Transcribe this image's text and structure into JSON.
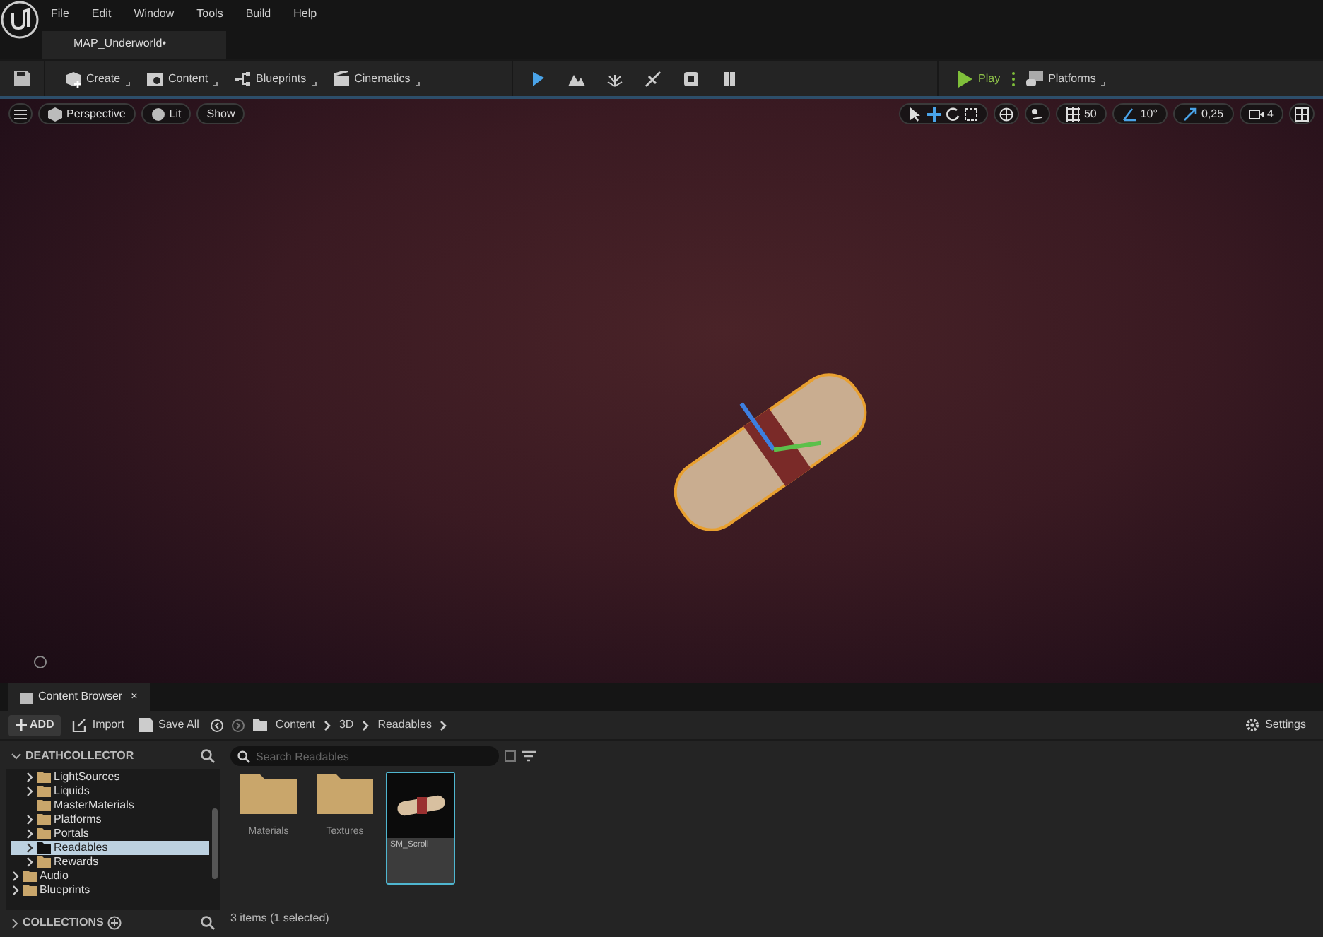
{
  "menu": [
    "File",
    "Edit",
    "Window",
    "Tools",
    "Build",
    "Help"
  ],
  "document_tab": {
    "label": "MAP_Underworld•"
  },
  "toolbar": {
    "menus": [
      {
        "label": "Create"
      },
      {
        "label": "Content"
      },
      {
        "label": "Blueprints"
      },
      {
        "label": "Cinematics"
      }
    ],
    "play": "Play",
    "platforms": "Platforms"
  },
  "viewport": {
    "left_buttons": [
      "Perspective",
      "Lit",
      "Show"
    ],
    "snap_values": [
      {
        "kind": "grid",
        "label": "50"
      },
      {
        "kind": "angle",
        "label": "10°"
      },
      {
        "kind": "scale",
        "label": "0,25"
      },
      {
        "kind": "camera",
        "label": "4"
      }
    ]
  },
  "content_browser": {
    "tab": "Content Browser",
    "close": "×",
    "actions": [
      "ADD",
      "Import",
      "Save All"
    ],
    "breadcrumb": [
      "Content",
      "3D",
      "Readables"
    ],
    "settings": "Settings",
    "tree_title": "DEATHCOLLECTOR",
    "tree": [
      {
        "children": [
          {
            "label": "LightSources",
            "has_children": true,
            "selected": false
          },
          {
            "label": "Liquids",
            "has_children": true,
            "selected": false
          },
          {
            "label": "MasterMaterials",
            "has_children": false,
            "selected": false
          },
          {
            "label": "Platforms",
            "has_children": true,
            "selected": false
          },
          {
            "label": "Portals",
            "has_children": true,
            "selected": false
          },
          {
            "label": "Readables",
            "has_children": true,
            "selected": true
          },
          {
            "label": "Rewards",
            "has_children": true,
            "selected": false
          }
        ]
      },
      {
        "label": "Audio",
        "has_children": true,
        "selected": false
      },
      {
        "label": "Blueprints",
        "has_children": true,
        "selected": false
      }
    ],
    "collections": "COLLECTIONS",
    "search": {
      "placeholder": "Search Readables"
    },
    "assets": [
      {
        "kind": "folder",
        "label": "Materials",
        "selected": false
      },
      {
        "kind": "folder",
        "label": "Textures",
        "selected": false
      },
      {
        "kind": "mesh",
        "label": "SM_Scroll",
        "selected": true
      }
    ],
    "status": "3 items (1 selected)"
  }
}
